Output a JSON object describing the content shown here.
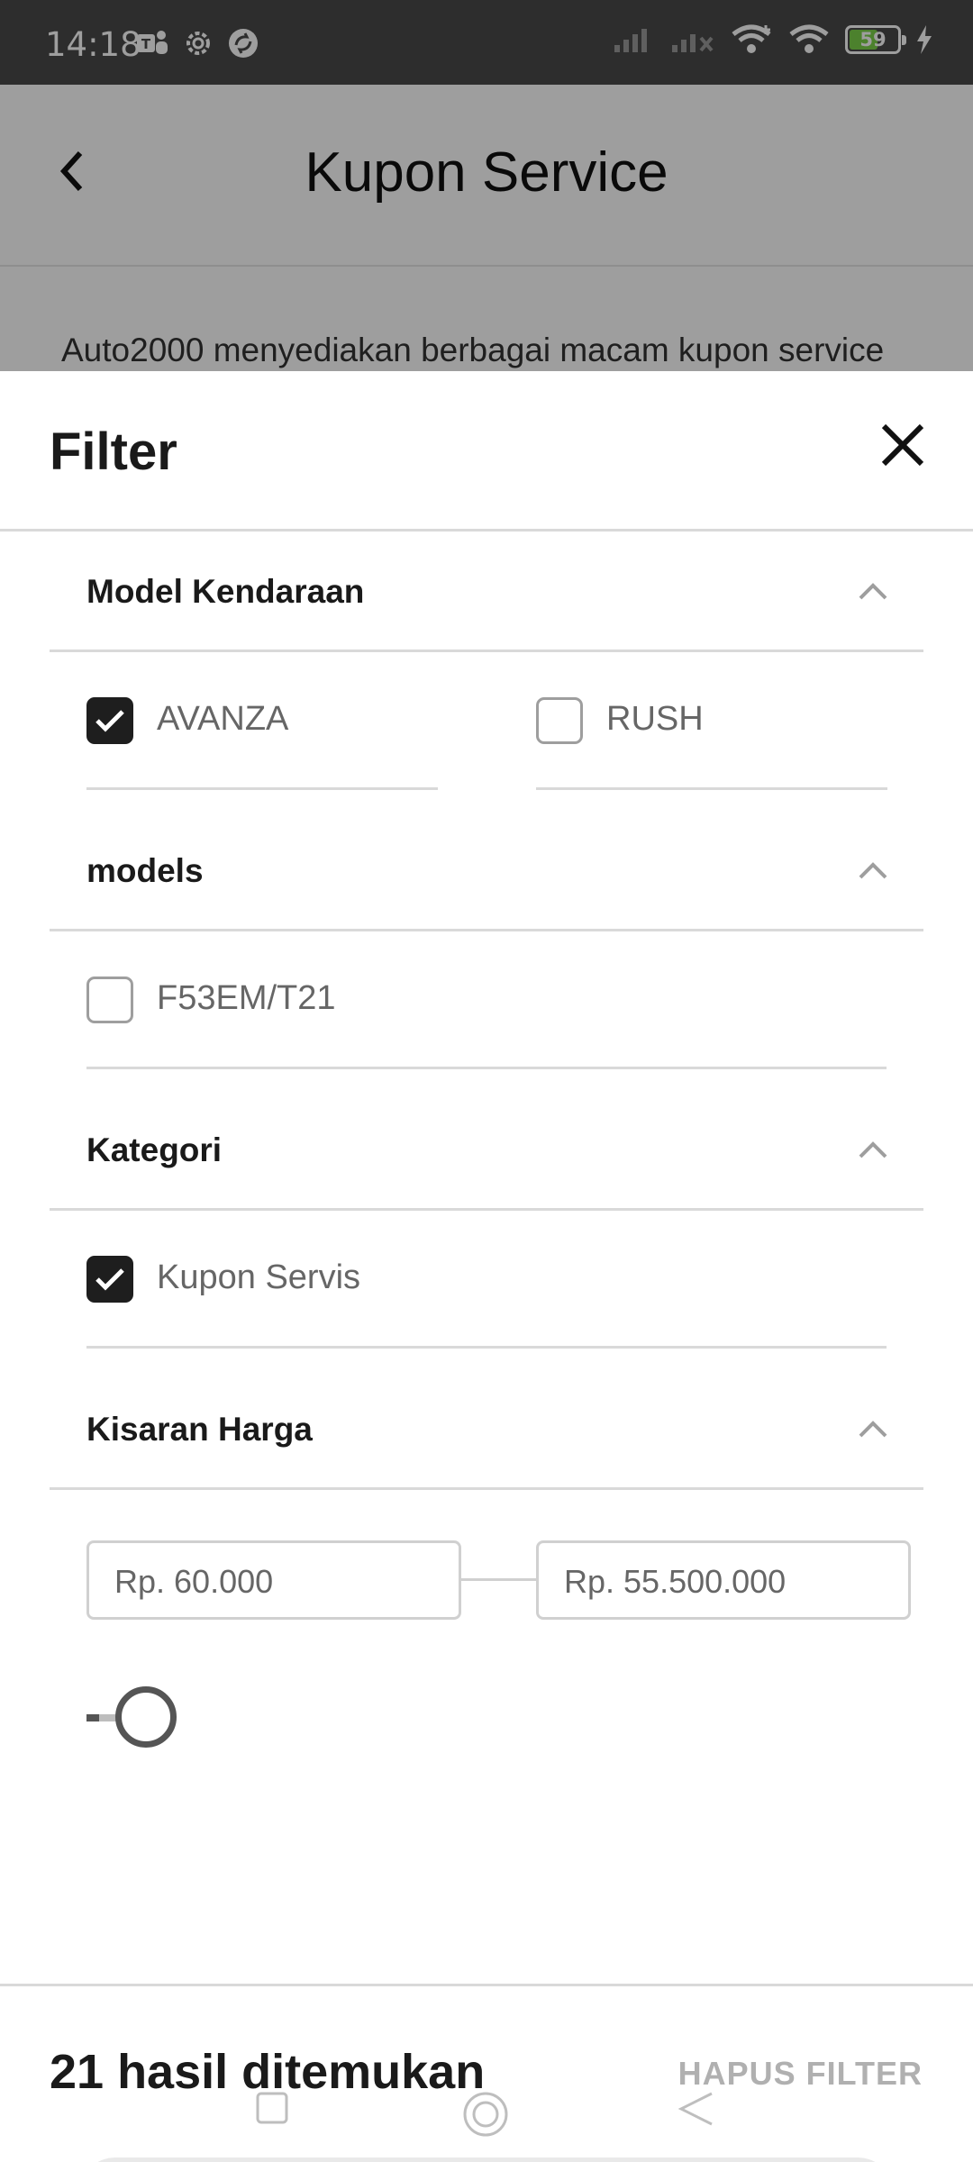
{
  "status_bar": {
    "time": "14:18",
    "battery": "59",
    "battery_level": 0.59
  },
  "app_bar": {
    "title": "Kupon Service"
  },
  "intro": {
    "text": "Auto2000 menyediakan berbagai macam kupon service"
  },
  "filter": {
    "title": "Filter",
    "sections": {
      "model": {
        "title": "Model Kendaraan",
        "options": [
          {
            "label": "AVANZA",
            "checked": true
          },
          {
            "label": "RUSH",
            "checked": false
          }
        ]
      },
      "models": {
        "title": "models",
        "options": [
          {
            "label": "F53EM/T21",
            "checked": false
          }
        ]
      },
      "kategori": {
        "title": "Kategori",
        "options": [
          {
            "label": "Kupon Servis",
            "checked": true
          }
        ]
      },
      "harga": {
        "title": "Kisaran Harga",
        "min": "Rp. 60.000",
        "max": "Rp. 55.500.000",
        "slider_level": 0.0
      }
    }
  },
  "footer": {
    "result_text": "21 hasil ditemukan",
    "clear_label": "HAPUS FILTER"
  }
}
